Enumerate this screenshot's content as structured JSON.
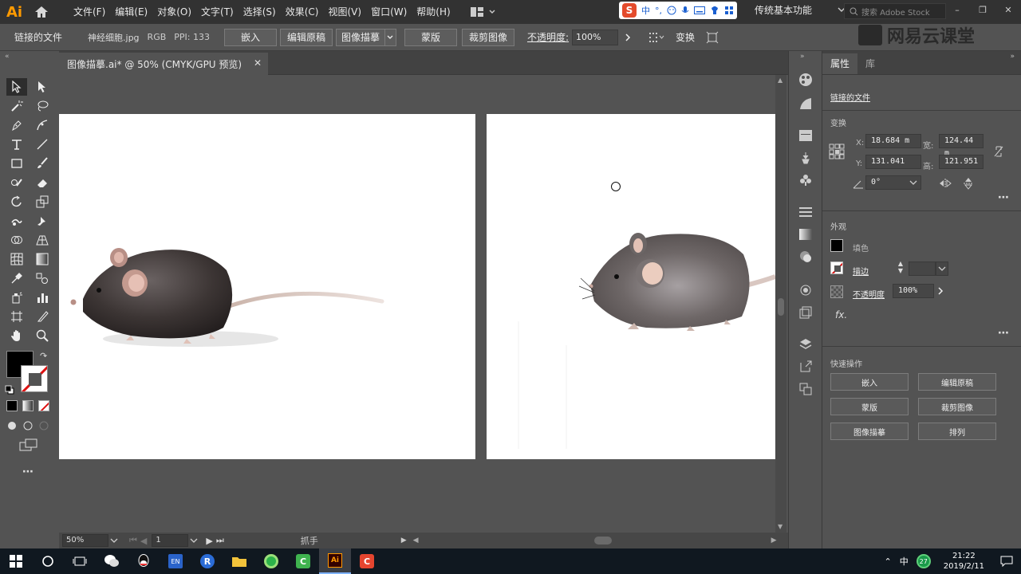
{
  "app": {
    "logo": "Ai"
  },
  "menu": [
    "文件(F)",
    "编辑(E)",
    "对象(O)",
    "文字(T)",
    "选择(S)",
    "效果(C)",
    "视图(V)",
    "窗口(W)",
    "帮助(H)"
  ],
  "ime": {
    "brand": "S",
    "mode": "中",
    "punct": "°,"
  },
  "workspace": "传统基本功能",
  "stock_search": {
    "placeholder": "搜索 Adobe Stock"
  },
  "control_bar": {
    "linked_file": "链接的文件",
    "filename": "神经细胞.jpg",
    "color_mode": "RGB",
    "ppi": "PPI: 133",
    "embed": "嵌入",
    "edit_original": "编辑原稿",
    "image_trace": "图像描摹",
    "mask": "蒙版",
    "crop": "裁剪图像",
    "opacity_label": "不透明度:",
    "opacity_value": "100%",
    "transform": "变换"
  },
  "watermark": "网易云课堂",
  "document_tab": {
    "title": "图像描摹.ai* @ 50% (CMYK/GPU 预览)"
  },
  "status": {
    "zoom": "50%",
    "page": "1",
    "tool": "抓手"
  },
  "panel": {
    "tabs": [
      "属性",
      "库"
    ],
    "selection_type": "链接的文件",
    "transform": {
      "title": "变换",
      "x_label": "X:",
      "x": "18.684 m",
      "y_label": "Y:",
      "y": "131.041",
      "w_label": "宽:",
      "w": "124.44 m",
      "h_label": "高:",
      "h": "121.951",
      "angle": "0°"
    },
    "appearance": {
      "title": "外观",
      "fill": "填色",
      "stroke": "描边",
      "opacity": "不透明度",
      "opacity_value": "100%",
      "fx": "fx."
    },
    "quick_actions": {
      "title": "快速操作",
      "buttons": [
        "嵌入",
        "编辑原稿",
        "蒙版",
        "裁剪图像",
        "图像描摹",
        "排列"
      ]
    }
  },
  "taskbar": {
    "ime": "中",
    "badge": "27",
    "time": "21:22",
    "date": "2019/2/11"
  },
  "colors": {
    "accent_ai": "#ff9a00",
    "chrome_dark": "#323232",
    "panel_gray": "#535353"
  }
}
